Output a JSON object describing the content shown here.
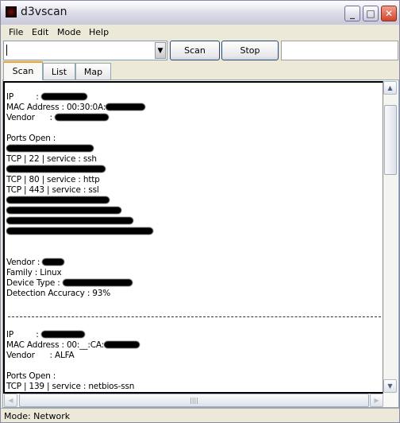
{
  "window": {
    "title": "d3vscan"
  },
  "menu": [
    "File",
    "Edit",
    "Mode",
    "Help"
  ],
  "toolbar": {
    "target_value": "",
    "scan_label": "Scan",
    "stop_label": "Stop",
    "extra_value": ""
  },
  "tabs": [
    {
      "label": "Scan",
      "active": true
    },
    {
      "label": "List",
      "active": false
    },
    {
      "label": "Map",
      "active": false
    }
  ],
  "output": {
    "hosts": [
      {
        "lines": [
          {
            "text": "IP         : ",
            "redacted": true
          },
          {
            "text": "MAC Address : 00:30:0A:",
            "redacted": true
          },
          {
            "text": "Vendor      : ",
            "redacted": true
          },
          {
            "text": ""
          },
          {
            "text": "Ports Open :"
          },
          {
            "text": "",
            "redacted": true
          },
          {
            "text": "TCP | 22 | service : ssh"
          },
          {
            "text": "",
            "redacted": true
          },
          {
            "text": "TCP | 80 | service : http"
          },
          {
            "text": "TCP | 443 | service : ssl"
          },
          {
            "text": "",
            "redacted": true
          },
          {
            "text": "",
            "redacted": true
          },
          {
            "text": "",
            "redacted": true
          },
          {
            "text": "",
            "redacted": true
          },
          {
            "text": ""
          },
          {
            "text": ""
          },
          {
            "text": "Vendor : ",
            "redacted": true
          },
          {
            "text": "Family : Linux"
          },
          {
            "text": "Device Type : ",
            "redacted": true
          },
          {
            "text": "Detection Accuracy : 93%"
          }
        ]
      },
      {
        "lines": [
          {
            "text": "IP         : ",
            "redacted": true
          },
          {
            "text": "MAC Address : 00:__:CA:",
            "redacted": true
          },
          {
            "text": "Vendor      : ALFA"
          },
          {
            "text": ""
          },
          {
            "text": "Ports Open :"
          },
          {
            "text": "TCP | 139 | service : netbios-ssn"
          }
        ]
      }
    ]
  },
  "status": {
    "text": "Mode: Network"
  }
}
